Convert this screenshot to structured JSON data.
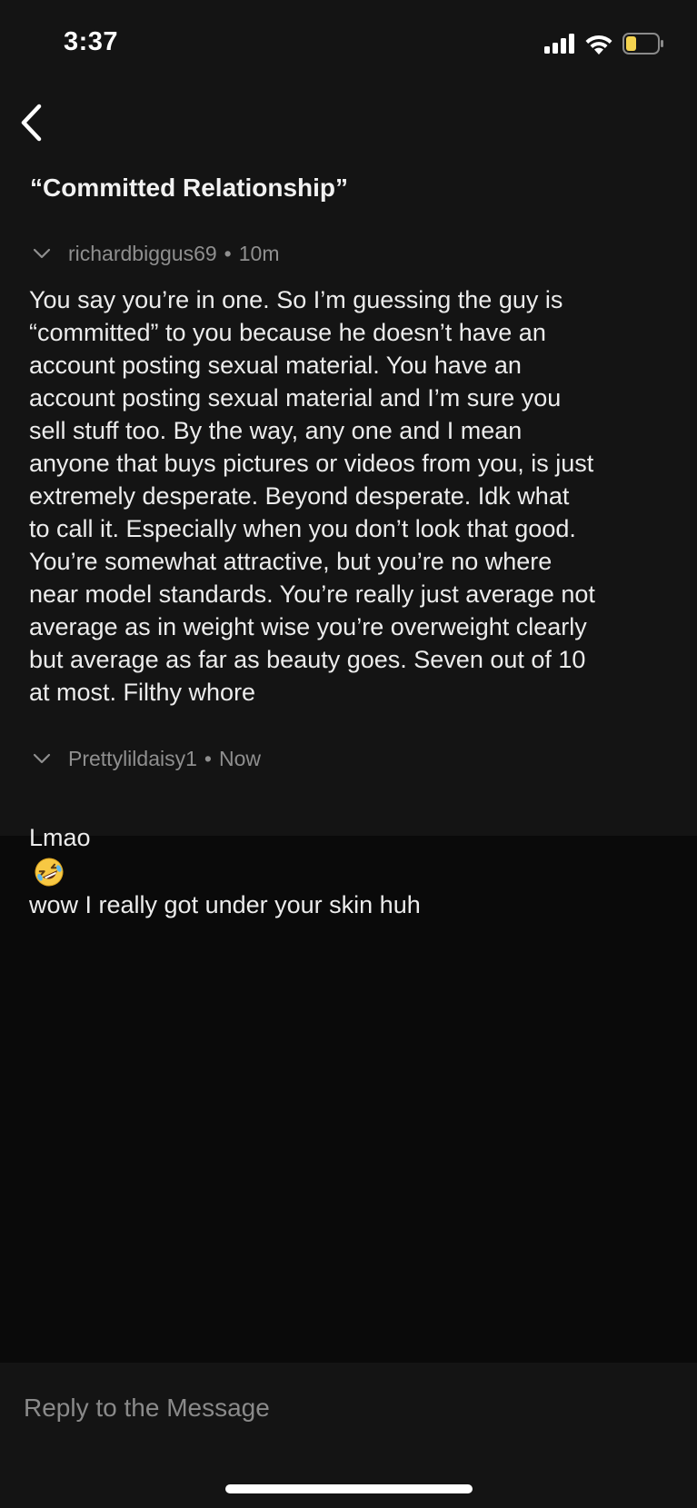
{
  "status_bar": {
    "time": "3:37",
    "icons": [
      "signal-icon",
      "wifi-icon",
      "battery-icon"
    ],
    "battery_color": "#f4d34f"
  },
  "header": {
    "back_icon": "chevron-left-icon",
    "title": "“Committed Relationship”"
  },
  "comments": [
    {
      "author": "richardbiggus69",
      "separator": "•",
      "time": "10m",
      "body": "You say you’re in one. So I’m guessing the guy is\n“committed” to you because he doesn’t have an\naccount posting sexual material. You have an\naccount posting sexual material and I’m sure you\nsell stuff too. By the way, any one and I mean\nanyone that buys pictures or videos from you, is just\nextremely desperate. Beyond desperate. Idk what\nto call it. Especially when you don’t look that good.\nYou’re somewhat attractive, but you’re no where\nnear model standards. You’re really just average not\naverage as in weight wise you’re overweight clearly\nbut average as far as beauty goes. Seven out of 10\nat most. Filthy whore"
    },
    {
      "author": "Prettylildaisy1",
      "separator": "•",
      "time": "Now",
      "body_before_emoji": "Lmao",
      "emoji": "rolling-on-floor-laughing-emoji",
      "body_after_emoji": "wow I really got under your skin huh"
    }
  ],
  "reply": {
    "placeholder": "Reply to the Message",
    "value": ""
  },
  "colors": {
    "background": "#0a0a0a",
    "surface": "#141414",
    "text_primary": "#ececec",
    "text_secondary": "#8f8f8f"
  }
}
